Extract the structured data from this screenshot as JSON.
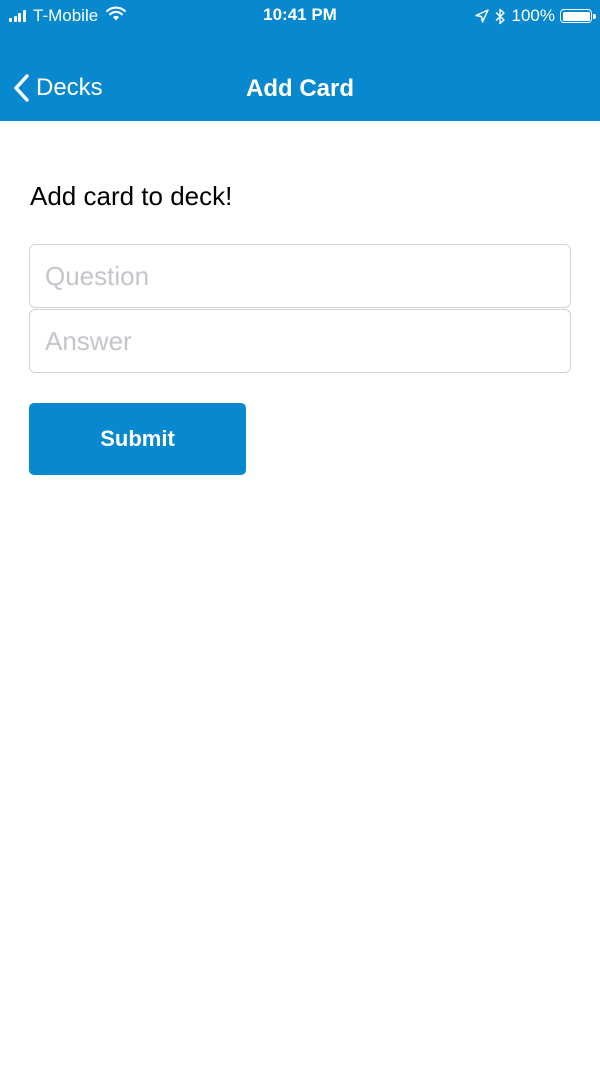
{
  "status_bar": {
    "carrier": "T-Mobile",
    "time": "10:41 PM",
    "battery_percent": "100%",
    "icons": [
      "signal-icon",
      "wifi-icon",
      "location-arrow-icon",
      "bluetooth-icon",
      "battery-icon"
    ]
  },
  "nav": {
    "back_label": "Decks",
    "title": "Add Card"
  },
  "form": {
    "heading": "Add card to deck!",
    "question_placeholder": "Question",
    "question_value": "",
    "answer_placeholder": "Answer",
    "answer_value": "",
    "submit_label": "Submit"
  },
  "colors": {
    "accent": "#0788cf",
    "background": "#ffffff",
    "input_border": "#d3d3d8",
    "placeholder": "#c5c5cb"
  }
}
